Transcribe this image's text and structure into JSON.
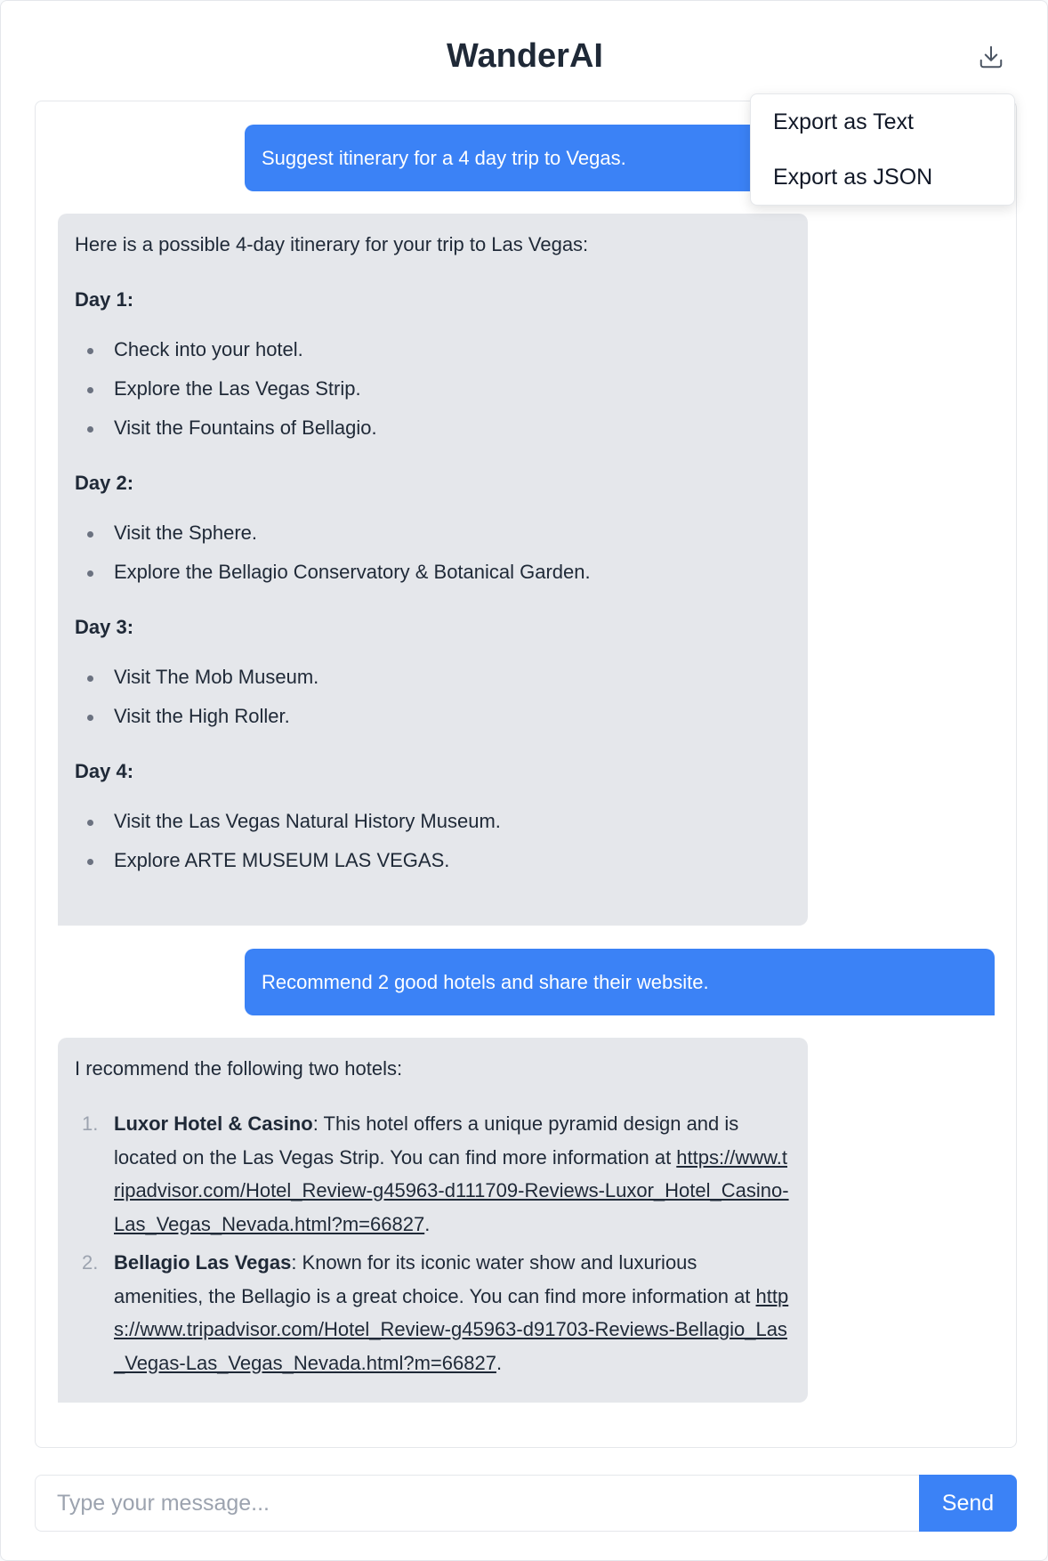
{
  "app": {
    "title": "WanderAI"
  },
  "header": {
    "download_icon": "download-icon"
  },
  "export_menu": {
    "items": [
      "Export as Text",
      "Export as JSON"
    ]
  },
  "messages": {
    "user_1": "Suggest itinerary for a 4 day trip to Vegas.",
    "bot_1": {
      "intro": "Here is a possible 4-day itinerary for your trip to Las Vegas:",
      "days": [
        {
          "heading": "Day 1:",
          "items": [
            "Check into your hotel.",
            "Explore the Las Vegas Strip.",
            "Visit the Fountains of Bellagio."
          ]
        },
        {
          "heading": "Day 2:",
          "items": [
            "Visit the Sphere.",
            "Explore the Bellagio Conservatory & Botanical Garden."
          ]
        },
        {
          "heading": "Day 3:",
          "items": [
            "Visit The Mob Museum.",
            "Visit the High Roller."
          ]
        },
        {
          "heading": "Day 4:",
          "items": [
            "Visit the Las Vegas Natural History Museum.",
            "Explore ARTE MUSEUM LAS VEGAS."
          ]
        }
      ]
    },
    "user_2": "Recommend 2 good hotels and share their website.",
    "bot_2": {
      "intro": "I recommend the following two hotels:",
      "hotels": [
        {
          "number": "1.",
          "name": "Luxor Hotel & Casino",
          "description": ": This hotel offers a unique pyramid design and is located on the Las Vegas Strip. You can find more information at ",
          "url": "https://www.tripadvisor.com/Hotel_Review-g45963-d111709-Reviews-Luxor_Hotel_Casino-Las_Vegas_Nevada.html?m=66827",
          "end": "."
        },
        {
          "number": "2.",
          "name": "Bellagio Las Vegas",
          "description": ": Known for its iconic water show and luxurious amenities, the Bellagio is a great choice. You can find more information at ",
          "url": "https://www.tripadvisor.com/Hotel_Review-g45963-d91703-Reviews-Bellagio_Las_Vegas-Las_Vegas_Nevada.html?m=66827",
          "end": "."
        }
      ]
    }
  },
  "composer": {
    "placeholder": "Type your message...",
    "value": "",
    "send_label": "Send"
  },
  "colors": {
    "accent": "#3b82f6",
    "bot_bubble": "#e5e7eb",
    "text": "#1f2937"
  }
}
